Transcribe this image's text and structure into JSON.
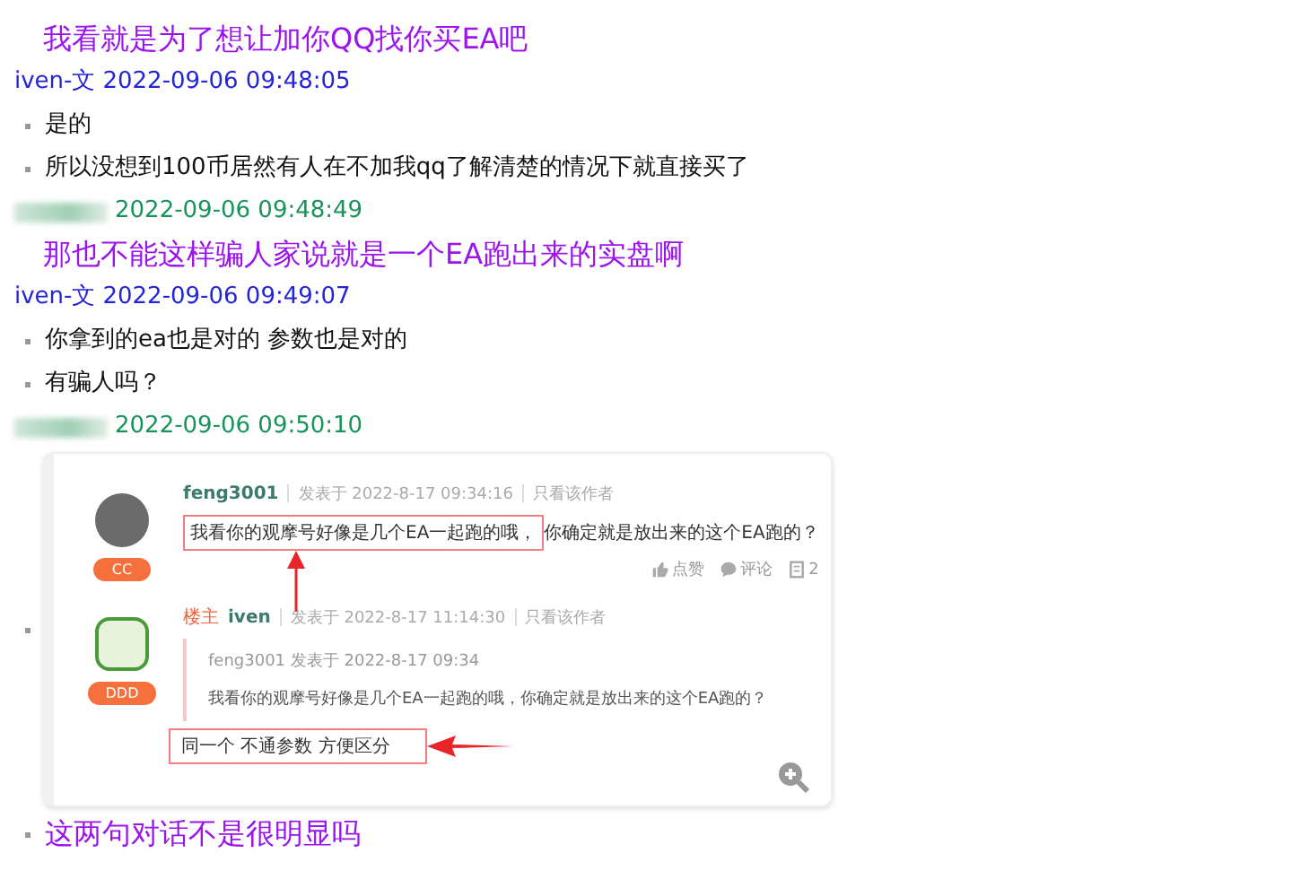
{
  "entries": [
    {
      "kind": "big",
      "text": "我看就是为了想让加你QQ找你买EA吧"
    },
    {
      "kind": "header",
      "name_hidden": false,
      "author": "iven-文",
      "time": "2022-09-06 09:48:05",
      "color": "#2323d8"
    },
    {
      "kind": "bullet",
      "text": "是的"
    },
    {
      "kind": "bullet",
      "text": "所以没想到100币居然有人在不加我qq了解清楚的情况下就直接买了"
    },
    {
      "kind": "header",
      "name_hidden": true,
      "time": "2022-09-06 09:48:49",
      "color": "#17945a"
    },
    {
      "kind": "big",
      "text": "那也不能这样骗人家说就是一个EA跑出来的实盘啊"
    },
    {
      "kind": "header",
      "name_hidden": false,
      "author": "iven-文",
      "time": "2022-09-06 09:49:07",
      "color": "#2323d8"
    },
    {
      "kind": "bullet",
      "text": "你拿到的ea也是对的  参数也是对的"
    },
    {
      "kind": "bullet",
      "text": "有骗人吗？"
    },
    {
      "kind": "header",
      "name_hidden": true,
      "time": "2022-09-06 09:50:10",
      "color": "#17945a"
    },
    {
      "kind": "image"
    },
    {
      "kind": "big_bullet",
      "text": "这两句对话不是很明显吗"
    }
  ],
  "screenshot": {
    "posts": [
      {
        "author": "feng3001",
        "posted": "发表于 2022-8-17 09:34:16",
        "author_only": "只看该作者",
        "badge": "CC",
        "body": [
          {
            "text": "我看你的观摩号好像是几个EA一起跑的哦，",
            "kind": "boxed_up"
          },
          {
            "text": "你确定就是放出来的这个EA跑的？",
            "kind": "plain"
          }
        ],
        "actions": [
          {
            "kind": "like",
            "label": "点赞"
          },
          {
            "kind": "comment",
            "label": "评论"
          },
          {
            "kind": "count",
            "label": "2"
          }
        ]
      },
      {
        "tag": "楼主",
        "author": "iven",
        "posted": "发表于 2022-8-17 11:14:30",
        "author_only": "只看该作者",
        "badge": "DDD",
        "quote": {
          "author": "feng3001",
          "posted": "发表于 2022-8-17 09:34",
          "text": "我看你的观摩号好像是几个EA一起跑的哦，你确定就是放出来的这个EA跑的？"
        },
        "body": [
          {
            "text": "同一个 不通参数 方便区分",
            "kind": "boxed_left"
          }
        ],
        "zoom": true
      }
    ]
  }
}
